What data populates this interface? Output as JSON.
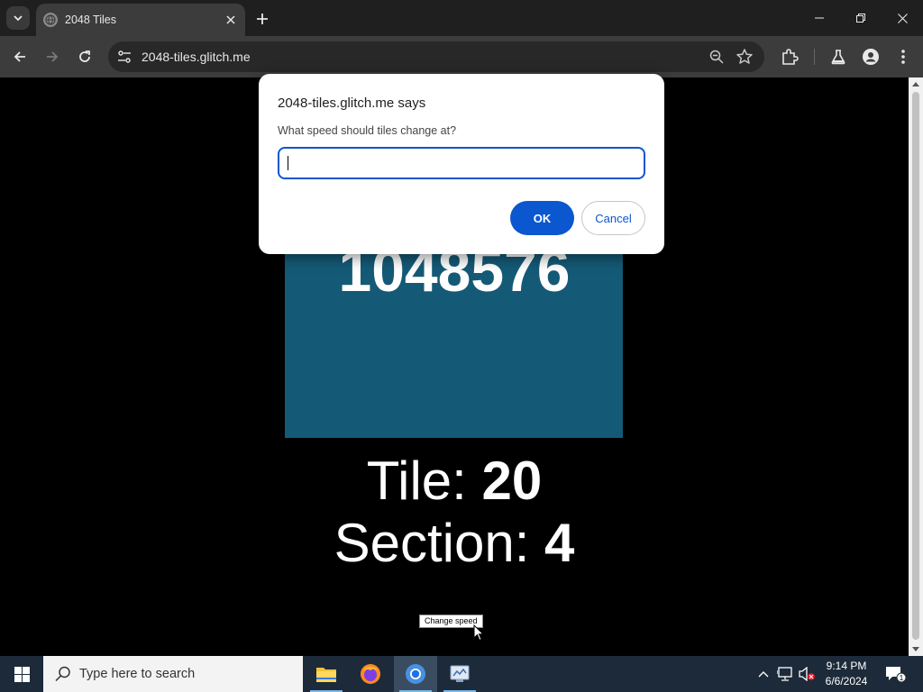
{
  "browser": {
    "tab_title": "2048 Tiles",
    "url": "2048-tiles.glitch.me"
  },
  "page": {
    "tile_value": "1048576",
    "tile_label": "Tile: ",
    "tile_number": "20",
    "section_label": "Section: ",
    "section_number": "4",
    "change_speed_label": "Change speed",
    "tile_color": "#145a76"
  },
  "dialog": {
    "title": "2048-tiles.glitch.me says",
    "message": "What speed should tiles change at?",
    "input_value": "",
    "ok_label": "OK",
    "cancel_label": "Cancel",
    "accent": "#0b57d0"
  },
  "taskbar": {
    "search_placeholder": "Type here to search",
    "time": "9:14 PM",
    "date": "6/6/2024",
    "notification_count": "1",
    "apps": [
      "file-explorer-icon",
      "firefox-icon",
      "chrome-icon",
      "control-panel-icon"
    ]
  }
}
